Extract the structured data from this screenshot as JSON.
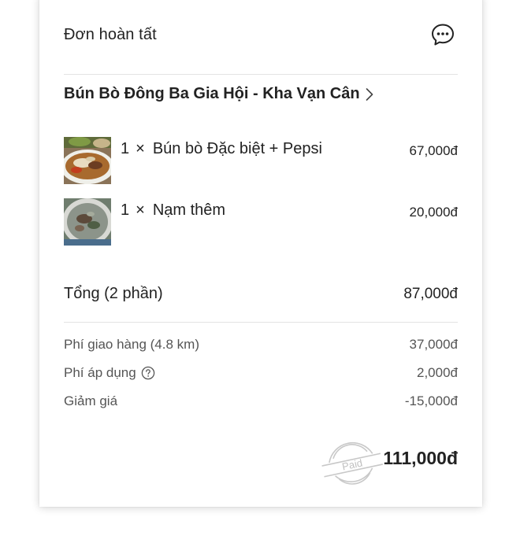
{
  "header": {
    "title": "Đơn hoàn tất",
    "chat_icon": "chat-bubble-icon"
  },
  "restaurant": {
    "name": "Bún Bò Đông Ba Gia Hội - Kha Vạn Cân",
    "chevron_icon": "chevron-right-icon"
  },
  "items": [
    {
      "qty": "1",
      "sep": "×",
      "name": "Bún bò Đặc biệt + Pepsi",
      "price": "67,000đ",
      "image": "bun-bo-photo"
    },
    {
      "qty": "1",
      "sep": "×",
      "name": "Nạm thêm",
      "price": "20,000đ",
      "image": "nam-soup-photo"
    }
  ],
  "summary": {
    "total_label": "Tổng (2 phần)",
    "total_value": "87,000đ"
  },
  "fees": [
    {
      "label": "Phí giao hàng (4.8 km)",
      "value": "37,000đ",
      "has_help": false
    },
    {
      "label": "Phí áp dụng",
      "value": "2,000đ",
      "has_help": true
    },
    {
      "label": "Giảm giá",
      "value": "-15,000đ",
      "has_help": false
    }
  ],
  "grand_total": "111,000đ",
  "stamp": {
    "text": "Paid"
  },
  "colors": {
    "text_primary": "#222222",
    "text_secondary": "#555555",
    "divider": "#e3e3e3",
    "stamp": "#c8c8c8"
  }
}
